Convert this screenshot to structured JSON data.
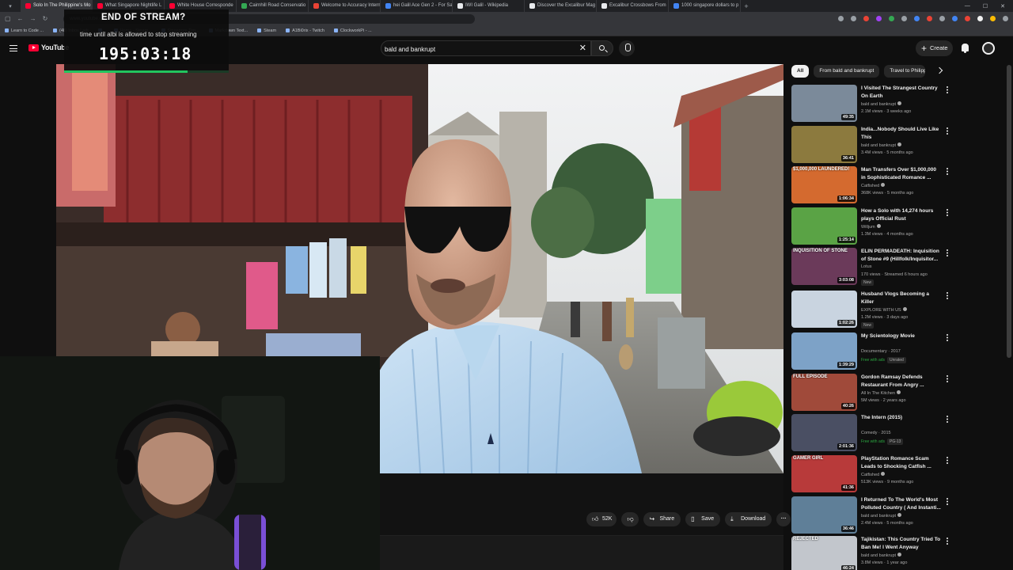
{
  "browser": {
    "tabs": [
      {
        "label": "Solo In The Philippine's Mo",
        "favicon": "#ff0033"
      },
      {
        "label": "What Singapore Nightlife L",
        "favicon": "#ff0033"
      },
      {
        "label": "White House Corresponde",
        "favicon": "#ff0033"
      },
      {
        "label": "Cairnhill Road Conservatio",
        "favicon": "#34a853"
      },
      {
        "label": "Welcome to Accuracy Intern",
        "favicon": "#ea4335"
      },
      {
        "label": "hei Galil Ace Gen 2 - For Sa",
        "favicon": "#4285f4"
      },
      {
        "label": "IWI Galil - Wikipedia",
        "favicon": "#e8eaed"
      },
      {
        "label": "Discover the Excalibur Mag",
        "favicon": "#e8eaed"
      },
      {
        "label": "Excalibur Crossbows From",
        "favicon": "#e8eaed"
      },
      {
        "label": "1000 singapore dollars to p",
        "favicon": "#4285f4"
      }
    ],
    "new_tab_label": "+",
    "url": "www.youtube.com/watch",
    "extension_colors": [
      "#9aa0a6",
      "#9aa0a6",
      "#ea4335",
      "#a142f4",
      "#34a853",
      "#9aa0a6",
      "#4285f4",
      "#ea4335",
      "#9aa0a6",
      "#4285f4",
      "#ea4335",
      "#f1f1f1",
      "#fbbc04",
      "#9aa0a6"
    ],
    "bookmarks": [
      "Learn to Code ...",
      "(48) Inbox | adi",
      "",
      "Home - Steam...",
      "Singapore Tim...",
      "Markdown Text...",
      "Steam",
      "A1Bi0rix - Twitch",
      "ClockworkPi - ..."
    ]
  },
  "youtube": {
    "logo_label": "YouTube",
    "search": {
      "query": "bald and bankrupt",
      "clear_icon": "✕"
    },
    "create_label": "Create",
    "accent": "#ff0033"
  },
  "overlay": {
    "title": "END OF STREAM?",
    "subtitle": "time until albi is allowed to stop streaming",
    "timer": "195:03:18",
    "progress_fraction": 0.75,
    "bar_color": "#22c55e"
  },
  "actions": {
    "likes": "52K",
    "share": "Share",
    "save": "Save",
    "download": "Download",
    "more": "···"
  },
  "chips": [
    "All",
    "From bald and bankrupt",
    "Travel to Philipp"
  ],
  "recommendations": [
    {
      "title": "I Visited The Strangest Country On Earth",
      "channel": "bald and bankrupt",
      "verified": true,
      "meta": "2.1M views · 3 weeks ago",
      "duration": "49:35",
      "badges": [],
      "thumb_color": "#7b8a9a"
    },
    {
      "title": "India...Nobody Should Live Like This",
      "channel": "bald and bankrupt",
      "verified": true,
      "meta": "3.4M views · 5 months ago",
      "duration": "36:41",
      "badges": [],
      "thumb_color": "#8c7a3e"
    },
    {
      "title": "Man Transfers Over $1,000,000 in Sophisticated Romance ...",
      "channel": "Catfished",
      "verified": true,
      "meta": "368K views · 5 months ago",
      "duration": "1:06:34",
      "tag": "$1,000,000 LAUNDERED!",
      "badges": [],
      "thumb_color": "#d46a2f"
    },
    {
      "title": "How a Solo with 14,274 hours plays Official Rust",
      "channel": "Willjum",
      "verified": true,
      "meta": "1.3M views · 4 months ago",
      "duration": "1:25:14",
      "badges": [],
      "thumb_color": "#5aa345"
    },
    {
      "title": "ELIN PERMADEATH: Inquisition of Stone #9 (Hillfolk/Inquisitor...",
      "channel": "Lotus",
      "verified": false,
      "meta": "170 views · Streamed 6 hours ago",
      "duration": "3:03:08",
      "tag": "INQUISITION OF STONE",
      "badges": [
        "New"
      ],
      "thumb_color": "#6b3a5a"
    },
    {
      "title": "Husband Vlogs Becoming a Killer",
      "channel": "EXPLORE WITH US",
      "verified": true,
      "meta": "1.2M views · 3 days ago",
      "duration": "1:02:26",
      "badges": [
        "New"
      ],
      "thumb_color": "#c9d4e0"
    },
    {
      "title": "My Scientology Movie",
      "channel": "Documentary · 2017",
      "verified": false,
      "meta": "",
      "duration": "1:39:29",
      "badges": [
        "Free with ads",
        "Unrated"
      ],
      "thumb_color": "#7da2c7"
    },
    {
      "title": "Gordon Ramsay Defends Restaurant From Angry ...",
      "channel": "All In The Kitchen",
      "verified": true,
      "meta": "5M views · 2 years ago",
      "duration": "40:26",
      "tag": "FULL EPISODE",
      "badges": [],
      "thumb_color": "#a04a3a"
    },
    {
      "title": "The Intern (2015)",
      "channel": "Comedy · 2015",
      "verified": false,
      "meta": "",
      "duration": "2:01:36",
      "badges": [
        "Free with ads",
        "PG-13"
      ],
      "thumb_color": "#4a4f63"
    },
    {
      "title": "PlayStation Romance Scam Leads to Shocking Catfish ...",
      "channel": "Catfished",
      "verified": true,
      "meta": "513K views · 9 months ago",
      "duration": "41:36",
      "tag": "GAMER GIRL",
      "badges": [],
      "thumb_color": "#b83a3a"
    },
    {
      "title": "I Returned To The World's Most Polluted Country ( And Instanti...",
      "channel": "bald and bankrupt",
      "verified": true,
      "meta": "2.4M views · 5 months ago",
      "duration": "36:46",
      "badges": [],
      "thumb_color": "#5f7f98"
    },
    {
      "title": "Tajikistan: This Country Tried To Ban Me! I Went Anyway",
      "channel": "bald and bankrupt",
      "verified": true,
      "meta": "3.8M views · 1 year ago",
      "duration": "46:24",
      "tag": "REJECTED",
      "badges": [],
      "thumb_color": "#c2c6cc"
    }
  ]
}
